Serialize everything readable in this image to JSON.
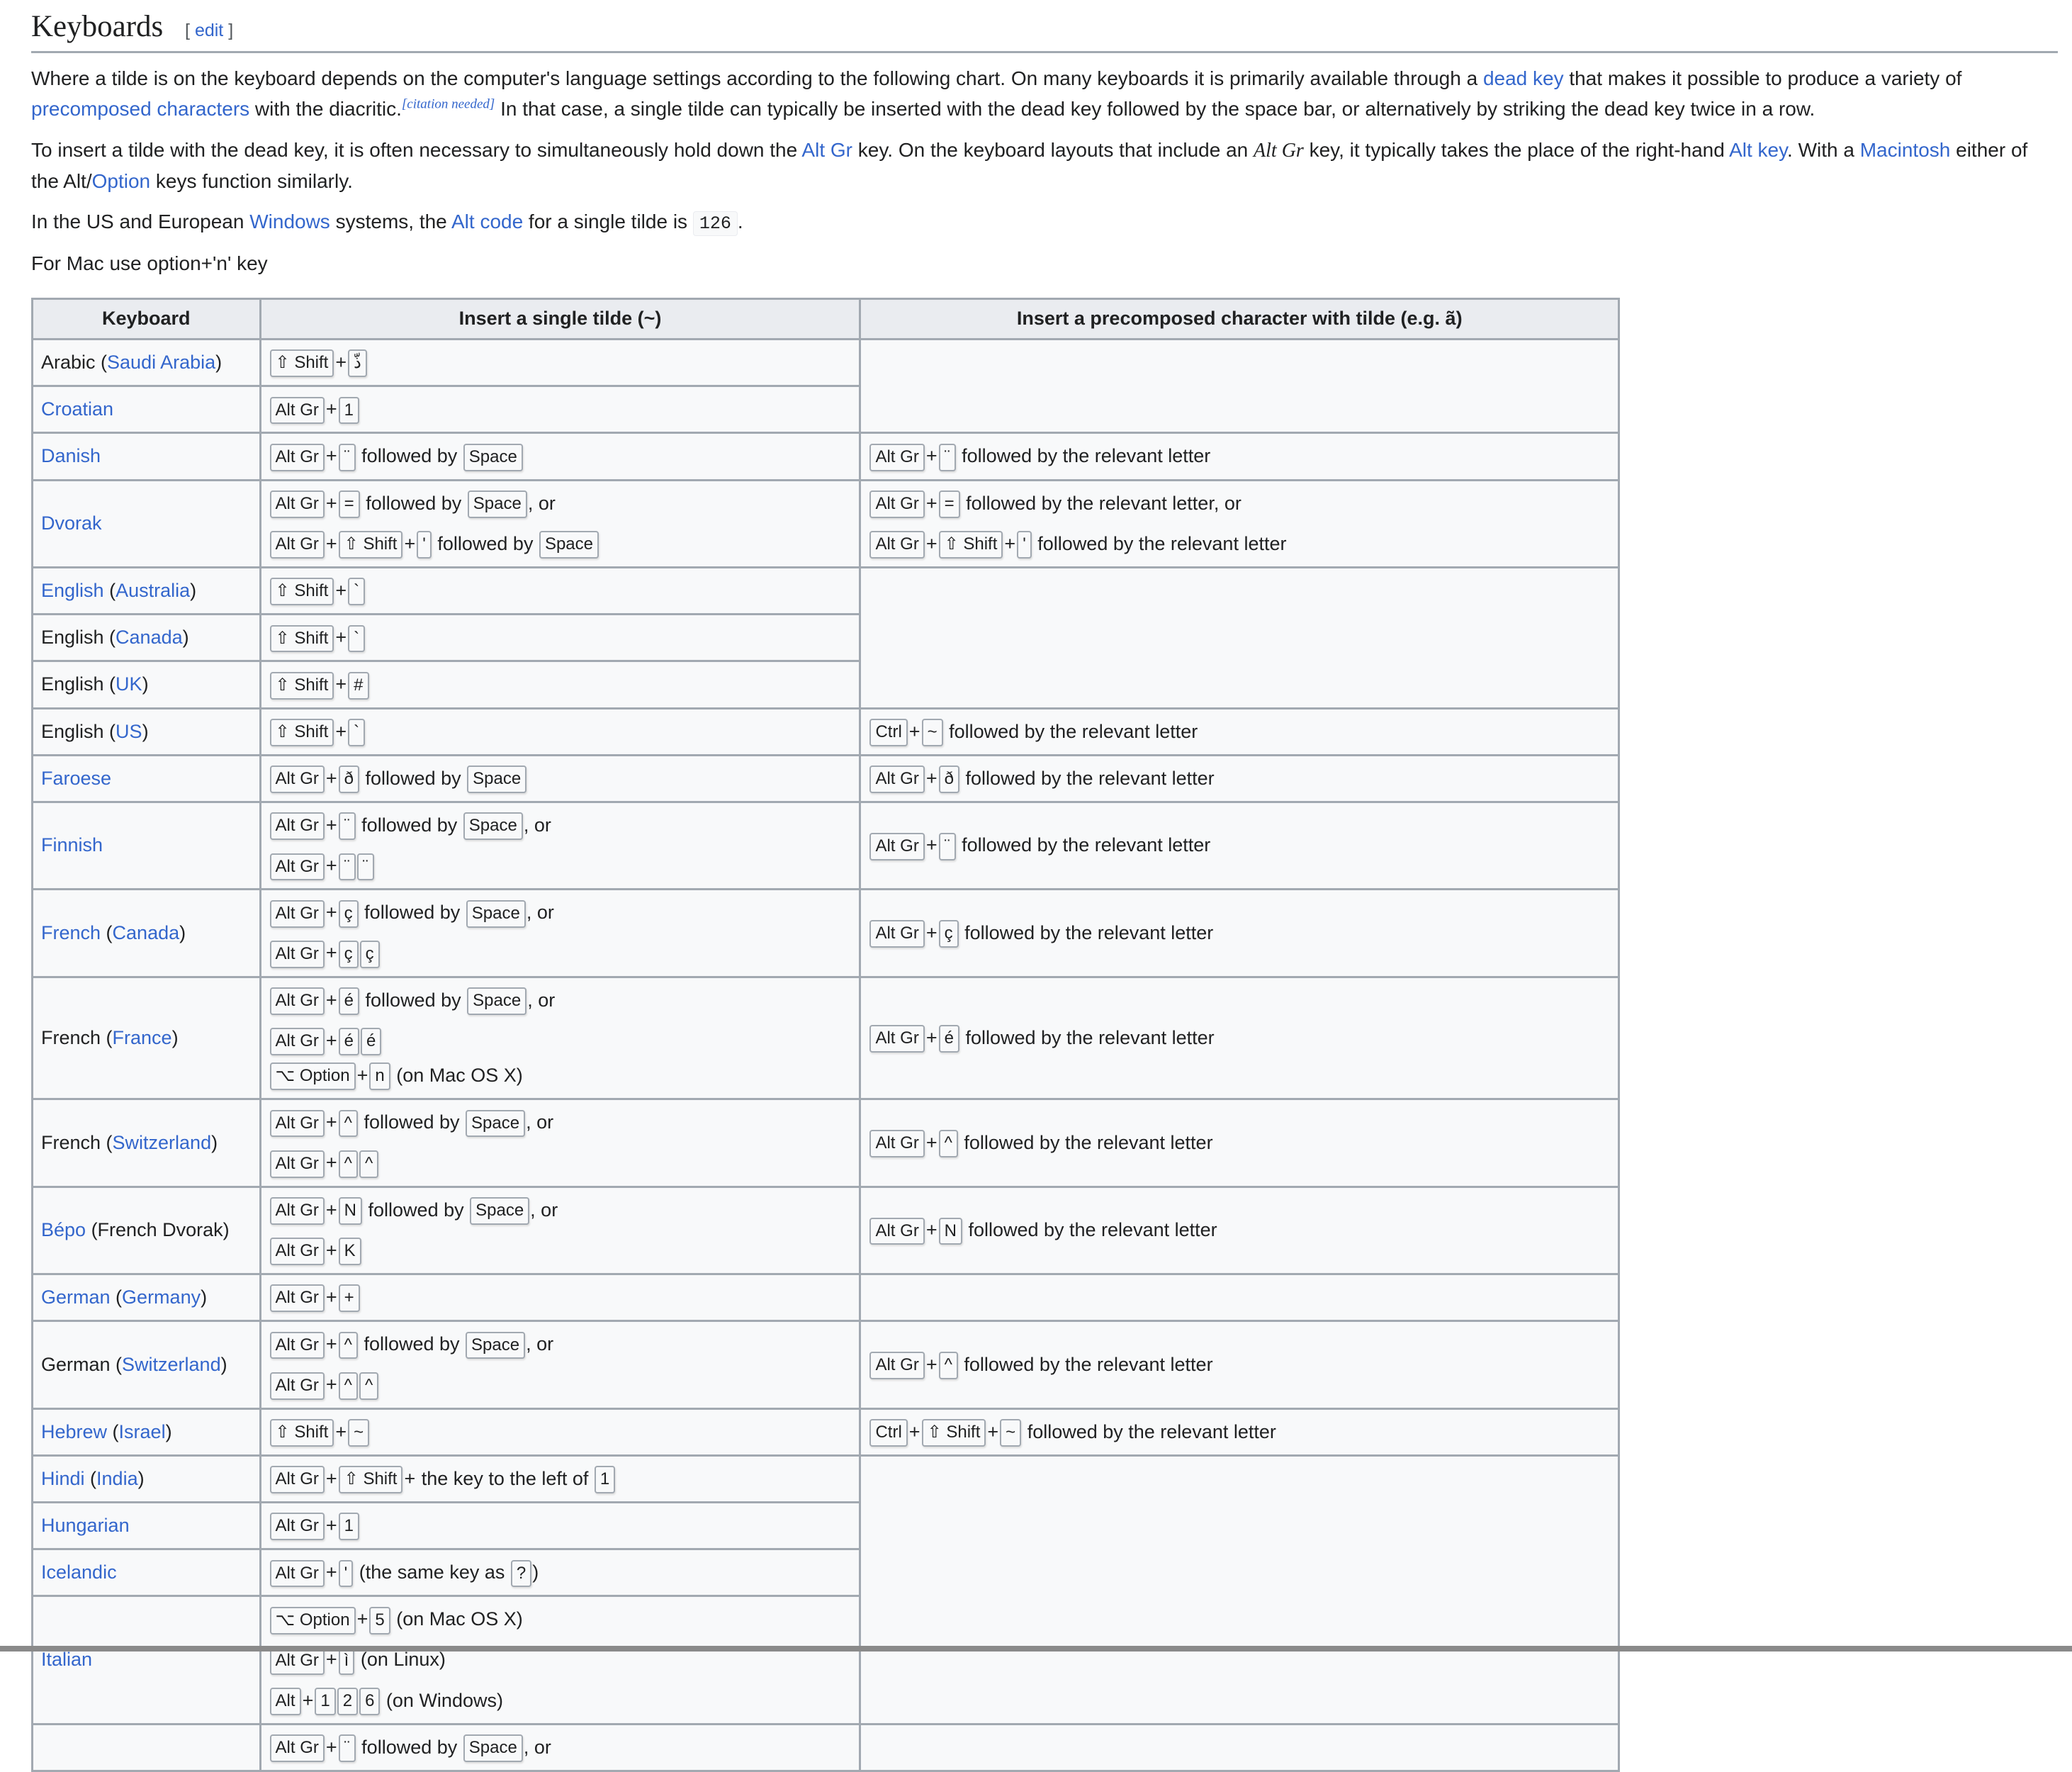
{
  "section": {
    "title": "Keyboards",
    "edit_label": "edit"
  },
  "paragraphs": {
    "p1": {
      "t1": "Where a tilde is on the keyboard depends on the computer's language settings according to the following chart. On many keyboards it is primarily available through a ",
      "link_dead_key": "dead key",
      "t2": " that makes it possible to produce a variety of ",
      "link_precomposed": "precomposed characters",
      "t3": " with the diacritic.",
      "citation": "[citation needed]",
      "t4": " In that case, a single tilde can typically be inserted with the dead key followed by the space bar, or alternatively by striking the dead key twice in a row."
    },
    "p2": {
      "t1": "To insert a tilde with the dead key, it is often necessary to simultaneously hold down the ",
      "link_alt_gr": "Alt Gr",
      "t2": " key. On the keyboard layouts that include an ",
      "altgr_italic": "Alt Gr",
      "t3": " key, it typically takes the place of the right-hand ",
      "link_alt_key": "Alt key",
      "t4": ". With a ",
      "link_macintosh": "Macintosh",
      "t5": " either of the Alt/",
      "link_option": "Option",
      "t6": " keys function similarly."
    },
    "p3": {
      "t1": "In the US and European ",
      "link_windows": "Windows",
      "t2": " systems, the ",
      "link_alt_code": "Alt code",
      "t3": " for a single tilde is ",
      "code": "126",
      "t4": "."
    },
    "p4": {
      "t1": "For Mac use option+'n' key"
    }
  },
  "table": {
    "headers": [
      "Keyboard",
      "Insert a single tilde (~)",
      "Insert a precomposed character with tilde (e.g. ã)"
    ],
    "rows": [
      {
        "kb": [
          {
            "t": "Arabic ("
          },
          {
            "l": "Saudi Arabia"
          },
          {
            "t": ")"
          }
        ],
        "single": [
          [
            {
              "k": "⇧ Shift"
            },
            {
              "p": "+"
            },
            {
              "k": "ذّ"
            }
          ]
        ],
        "pre": null,
        "pre_rowspan": 2
      },
      {
        "kb": [
          {
            "l": "Croatian"
          }
        ],
        "single": [
          [
            {
              "k": "Alt Gr"
            },
            {
              "p": "+"
            },
            {
              "k": "1"
            }
          ]
        ]
      },
      {
        "kb": [
          {
            "l": "Danish"
          }
        ],
        "single": [
          [
            {
              "k": "Alt Gr"
            },
            {
              "p": "+"
            },
            {
              "k": "¨"
            },
            {
              "t": " followed by "
            },
            {
              "k": "Space"
            }
          ]
        ],
        "pre": [
          [
            {
              "k": "Alt Gr"
            },
            {
              "p": "+"
            },
            {
              "k": "¨"
            },
            {
              "t": " followed by the relevant letter"
            }
          ]
        ]
      },
      {
        "kb": [
          {
            "l": "Dvorak"
          }
        ],
        "single": [
          [
            {
              "k": "Alt Gr"
            },
            {
              "p": "+"
            },
            {
              "k": "="
            },
            {
              "t": " followed by "
            },
            {
              "k": "Space"
            },
            {
              "t": ", or"
            }
          ],
          [
            {
              "k": "Alt Gr"
            },
            {
              "p": "+"
            },
            {
              "k": "⇧ Shift"
            },
            {
              "p": "+"
            },
            {
              "k": "'"
            },
            {
              "t": " followed by "
            },
            {
              "k": "Space"
            }
          ]
        ],
        "pre": [
          [
            {
              "k": "Alt Gr"
            },
            {
              "p": "+"
            },
            {
              "k": "="
            },
            {
              "t": " followed by the relevant letter, or"
            }
          ],
          [
            {
              "k": "Alt Gr"
            },
            {
              "p": "+"
            },
            {
              "k": "⇧ Shift"
            },
            {
              "p": "+"
            },
            {
              "k": "'"
            },
            {
              "t": " followed by the relevant letter"
            }
          ]
        ]
      },
      {
        "kb": [
          {
            "l": "English"
          },
          {
            "t": " ("
          },
          {
            "l": "Australia"
          },
          {
            "t": ")"
          }
        ],
        "single": [
          [
            {
              "k": "⇧ Shift"
            },
            {
              "p": "+"
            },
            {
              "k": "`"
            }
          ]
        ],
        "pre": null,
        "pre_rowspan": 3
      },
      {
        "kb": [
          {
            "t": "English ("
          },
          {
            "l": "Canada"
          },
          {
            "t": ")"
          }
        ],
        "single": [
          [
            {
              "k": "⇧ Shift"
            },
            {
              "p": "+"
            },
            {
              "k": "`"
            }
          ]
        ]
      },
      {
        "kb": [
          {
            "t": "English ("
          },
          {
            "l": "UK"
          },
          {
            "t": ")"
          }
        ],
        "single": [
          [
            {
              "k": "⇧ Shift"
            },
            {
              "p": "+"
            },
            {
              "k": "#"
            }
          ]
        ]
      },
      {
        "kb": [
          {
            "t": "English ("
          },
          {
            "l": "US"
          },
          {
            "t": ")"
          }
        ],
        "single": [
          [
            {
              "k": "⇧ Shift"
            },
            {
              "p": "+"
            },
            {
              "k": "`"
            }
          ]
        ],
        "pre": [
          [
            {
              "k": "Ctrl"
            },
            {
              "p": "+"
            },
            {
              "k": "~"
            },
            {
              "t": " followed by the relevant letter"
            }
          ]
        ]
      },
      {
        "kb": [
          {
            "l": "Faroese"
          }
        ],
        "single": [
          [
            {
              "k": "Alt Gr"
            },
            {
              "p": "+"
            },
            {
              "k": "ð"
            },
            {
              "t": " followed by "
            },
            {
              "k": "Space"
            }
          ]
        ],
        "pre": [
          [
            {
              "k": "Alt Gr"
            },
            {
              "p": "+"
            },
            {
              "k": "ð"
            },
            {
              "t": " followed by the relevant letter"
            }
          ]
        ]
      },
      {
        "kb": [
          {
            "l": "Finnish"
          }
        ],
        "single": [
          [
            {
              "k": "Alt Gr"
            },
            {
              "p": "+"
            },
            {
              "k": "¨"
            },
            {
              "t": " followed by "
            },
            {
              "k": "Space"
            },
            {
              "t": ", or"
            }
          ],
          [
            {
              "k": "Alt Gr"
            },
            {
              "p": "+"
            },
            {
              "k": "¨"
            },
            {
              "k": "¨"
            }
          ]
        ],
        "pre": [
          [
            {
              "k": "Alt Gr"
            },
            {
              "p": "+"
            },
            {
              "k": "¨"
            },
            {
              "t": " followed by the relevant letter"
            }
          ]
        ]
      },
      {
        "kb": [
          {
            "l": "French"
          },
          {
            "t": " ("
          },
          {
            "l": "Canada"
          },
          {
            "t": ")"
          }
        ],
        "single": [
          [
            {
              "k": "Alt Gr"
            },
            {
              "p": "+"
            },
            {
              "k": "ç"
            },
            {
              "t": " followed by "
            },
            {
              "k": "Space"
            },
            {
              "t": ", or"
            }
          ],
          [
            {
              "k": "Alt Gr"
            },
            {
              "p": "+"
            },
            {
              "k": "ç"
            },
            {
              "k": "ç"
            }
          ]
        ],
        "pre": [
          [
            {
              "k": "Alt Gr"
            },
            {
              "p": "+"
            },
            {
              "k": "ç"
            },
            {
              "t": " followed by the relevant letter"
            }
          ]
        ]
      },
      {
        "kb": [
          {
            "t": "French ("
          },
          {
            "l": "France"
          },
          {
            "t": ")"
          }
        ],
        "single": [
          [
            {
              "k": "Alt Gr"
            },
            {
              "p": "+"
            },
            {
              "k": "é"
            },
            {
              "t": " followed by "
            },
            {
              "k": "Space"
            },
            {
              "t": ", or"
            }
          ],
          [
            {
              "k": "Alt Gr"
            },
            {
              "p": "+"
            },
            {
              "k": "é"
            },
            {
              "k": "é"
            }
          ],
          [
            {
              "k": "⌥ Option"
            },
            {
              "p": "+"
            },
            {
              "k": "n"
            },
            {
              "t": " (on Mac OS X)"
            }
          ]
        ],
        "single_tight_last": true,
        "pre": [
          [
            {
              "k": "Alt Gr"
            },
            {
              "p": "+"
            },
            {
              "k": "é"
            },
            {
              "t": " followed by the relevant letter"
            }
          ]
        ]
      },
      {
        "kb": [
          {
            "t": "French ("
          },
          {
            "l": "Switzerland"
          },
          {
            "t": ")"
          }
        ],
        "single": [
          [
            {
              "k": "Alt Gr"
            },
            {
              "p": "+"
            },
            {
              "k": "^"
            },
            {
              "t": " followed by "
            },
            {
              "k": "Space"
            },
            {
              "t": ", or"
            }
          ],
          [
            {
              "k": "Alt Gr"
            },
            {
              "p": "+"
            },
            {
              "k": "^"
            },
            {
              "k": "^"
            }
          ]
        ],
        "pre": [
          [
            {
              "k": "Alt Gr"
            },
            {
              "p": "+"
            },
            {
              "k": "^"
            },
            {
              "t": " followed by the relevant letter"
            }
          ]
        ]
      },
      {
        "kb": [
          {
            "l": "Bépo"
          },
          {
            "t": " (French Dvorak)"
          }
        ],
        "single": [
          [
            {
              "k": "Alt Gr"
            },
            {
              "p": "+"
            },
            {
              "k": "N"
            },
            {
              "t": " followed by "
            },
            {
              "k": "Space"
            },
            {
              "t": ", or"
            }
          ],
          [
            {
              "k": "Alt Gr"
            },
            {
              "p": "+"
            },
            {
              "k": "K"
            }
          ]
        ],
        "pre": [
          [
            {
              "k": "Alt Gr"
            },
            {
              "p": "+"
            },
            {
              "k": "N"
            },
            {
              "t": " followed by the relevant letter"
            }
          ]
        ]
      },
      {
        "kb": [
          {
            "l": "German"
          },
          {
            "t": " ("
          },
          {
            "l": "Germany"
          },
          {
            "t": ")"
          }
        ],
        "single": [
          [
            {
              "k": "Alt Gr"
            },
            {
              "p": "+"
            },
            {
              "k": "+"
            }
          ]
        ],
        "pre": []
      },
      {
        "kb": [
          {
            "t": "German ("
          },
          {
            "l": "Switzerland"
          },
          {
            "t": ")"
          }
        ],
        "single": [
          [
            {
              "k": "Alt Gr"
            },
            {
              "p": "+"
            },
            {
              "k": "^"
            },
            {
              "t": " followed by "
            },
            {
              "k": "Space"
            },
            {
              "t": ", or"
            }
          ],
          [
            {
              "k": "Alt Gr"
            },
            {
              "p": "+"
            },
            {
              "k": "^"
            },
            {
              "k": "^"
            }
          ]
        ],
        "pre": [
          [
            {
              "k": "Alt Gr"
            },
            {
              "p": "+"
            },
            {
              "k": "^"
            },
            {
              "t": " followed by the relevant letter"
            }
          ]
        ]
      },
      {
        "kb": [
          {
            "l": "Hebrew"
          },
          {
            "t": " ("
          },
          {
            "l": "Israel"
          },
          {
            "t": ")"
          }
        ],
        "single": [
          [
            {
              "k": "⇧ Shift"
            },
            {
              "p": "+"
            },
            {
              "k": "~"
            }
          ]
        ],
        "pre": [
          [
            {
              "k": "Ctrl"
            },
            {
              "p": "+"
            },
            {
              "k": "⇧ Shift"
            },
            {
              "p": "+"
            },
            {
              "k": "~"
            },
            {
              "t": " followed by the relevant letter"
            }
          ]
        ]
      },
      {
        "kb": [
          {
            "l": "Hindi"
          },
          {
            "t": " ("
          },
          {
            "l": "India"
          },
          {
            "t": ")"
          }
        ],
        "single": [
          [
            {
              "k": "Alt Gr"
            },
            {
              "p": "+"
            },
            {
              "k": "⇧ Shift"
            },
            {
              "p": "+"
            },
            {
              "t": " the key to the left of "
            },
            {
              "k": "1"
            }
          ]
        ],
        "pre": null,
        "pre_rowspan": 4
      },
      {
        "kb": [
          {
            "l": "Hungarian"
          }
        ],
        "single": [
          [
            {
              "k": "Alt Gr"
            },
            {
              "p": "+"
            },
            {
              "k": "1"
            }
          ]
        ]
      },
      {
        "kb": [
          {
            "l": "Icelandic"
          }
        ],
        "single": [
          [
            {
              "k": "Alt Gr"
            },
            {
              "p": "+"
            },
            {
              "k": "'"
            },
            {
              "t": " (the same key as "
            },
            {
              "k": "?"
            },
            {
              "t": ")"
            }
          ]
        ]
      },
      {
        "kb": [
          {
            "l": "Italian"
          }
        ],
        "single": [
          [
            {
              "k": "⌥ Option"
            },
            {
              "p": "+"
            },
            {
              "k": "5"
            },
            {
              "t": " (on Mac OS X)"
            }
          ],
          [
            {
              "k": "Alt Gr"
            },
            {
              "p": "+"
            },
            {
              "k": "ì"
            },
            {
              "t": " (on Linux)"
            }
          ],
          [
            {
              "k": "Alt"
            },
            {
              "p": "+"
            },
            {
              "k": "1"
            },
            {
              "k": "2"
            },
            {
              "k": "6"
            },
            {
              "t": " (on Windows)"
            }
          ]
        ]
      },
      {
        "kb": [],
        "single": [
          [
            {
              "k": "Alt Gr"
            },
            {
              "p": "+"
            },
            {
              "k": "¨"
            },
            {
              "t": " followed by "
            },
            {
              "k": "Space"
            },
            {
              "t": ", or"
            }
          ]
        ],
        "pre": []
      }
    ]
  }
}
